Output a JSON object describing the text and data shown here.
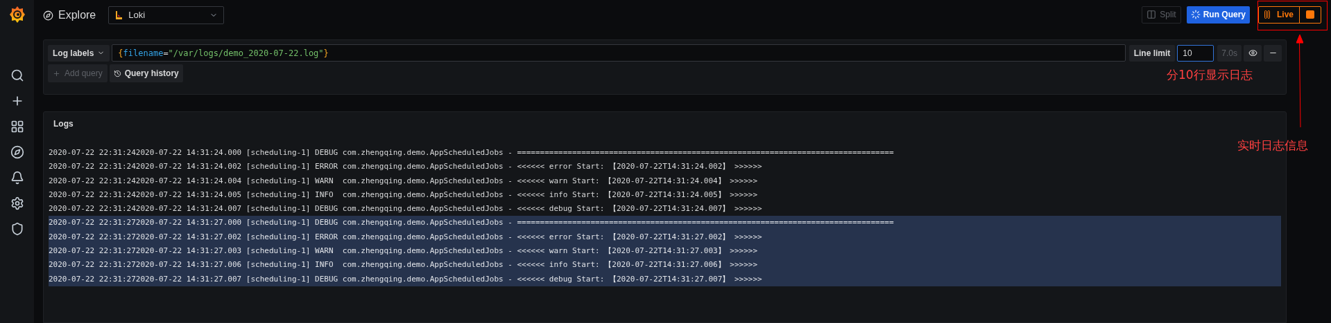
{
  "header": {
    "title": "Explore",
    "datasource": "Loki",
    "split": "Split",
    "run_query": "Run Query",
    "live": "Live"
  },
  "query": {
    "labels_button": "Log labels",
    "tokens": [
      {
        "kind": "brace",
        "text": "{"
      },
      {
        "kind": "label",
        "text": "filename"
      },
      {
        "kind": "operator",
        "text": "="
      },
      {
        "kind": "string",
        "text": "\"/var/logs/demo_2020-07-22.log\""
      },
      {
        "kind": "brace",
        "text": "}"
      }
    ],
    "line_limit_label": "Line limit",
    "line_limit": "10",
    "duration": "7.0s",
    "add_query": "Add query",
    "query_history": "Query history"
  },
  "logs": {
    "title": "Logs",
    "lines": [
      {
        "highlighted": false,
        "text": "2020-07-22 22:31:242020-07-22 14:31:24.000 [scheduling-1] DEBUG com.zhengqing.demo.AppScheduledJobs - =================================================================================="
      },
      {
        "highlighted": false,
        "text": "2020-07-22 22:31:242020-07-22 14:31:24.002 [scheduling-1] ERROR com.zhengqing.demo.AppScheduledJobs - <<<<<< error Start: 【2020-07-22T14:31:24.002】 >>>>>>"
      },
      {
        "highlighted": false,
        "text": "2020-07-22 22:31:242020-07-22 14:31:24.004 [scheduling-1] WARN  com.zhengqing.demo.AppScheduledJobs - <<<<<< warn Start: 【2020-07-22T14:31:24.004】 >>>>>>"
      },
      {
        "highlighted": false,
        "text": "2020-07-22 22:31:242020-07-22 14:31:24.005 [scheduling-1] INFO  com.zhengqing.demo.AppScheduledJobs - <<<<<< info Start: 【2020-07-22T14:31:24.005】 >>>>>>"
      },
      {
        "highlighted": false,
        "text": "2020-07-22 22:31:242020-07-22 14:31:24.007 [scheduling-1] DEBUG com.zhengqing.demo.AppScheduledJobs - <<<<<< debug Start: 【2020-07-22T14:31:24.007】 >>>>>>"
      },
      {
        "highlighted": true,
        "text": "2020-07-22 22:31:272020-07-22 14:31:27.000 [scheduling-1] DEBUG com.zhengqing.demo.AppScheduledJobs - =================================================================================="
      },
      {
        "highlighted": true,
        "text": "2020-07-22 22:31:272020-07-22 14:31:27.002 [scheduling-1] ERROR com.zhengqing.demo.AppScheduledJobs - <<<<<< error Start: 【2020-07-22T14:31:27.002】 >>>>>>"
      },
      {
        "highlighted": true,
        "text": "2020-07-22 22:31:272020-07-22 14:31:27.003 [scheduling-1] WARN  com.zhengqing.demo.AppScheduledJobs - <<<<<< warn Start: 【2020-07-22T14:31:27.003】 >>>>>>"
      },
      {
        "highlighted": true,
        "text": "2020-07-22 22:31:272020-07-22 14:31:27.006 [scheduling-1] INFO  com.zhengqing.demo.AppScheduledJobs - <<<<<< info Start: 【2020-07-22T14:31:27.006】 >>>>>>"
      },
      {
        "highlighted": true,
        "text": "2020-07-22 22:31:272020-07-22 14:31:27.007 [scheduling-1] DEBUG com.zhengqing.demo.AppScheduledJobs - <<<<<< debug Start: 【2020-07-22T14:31:27.007】 >>>>>>"
      }
    ]
  },
  "annotations": [
    {
      "kind": "line_limit_note",
      "text": "分10行显示日志"
    },
    {
      "kind": "live_note",
      "text": "实时日志信息"
    }
  ]
}
